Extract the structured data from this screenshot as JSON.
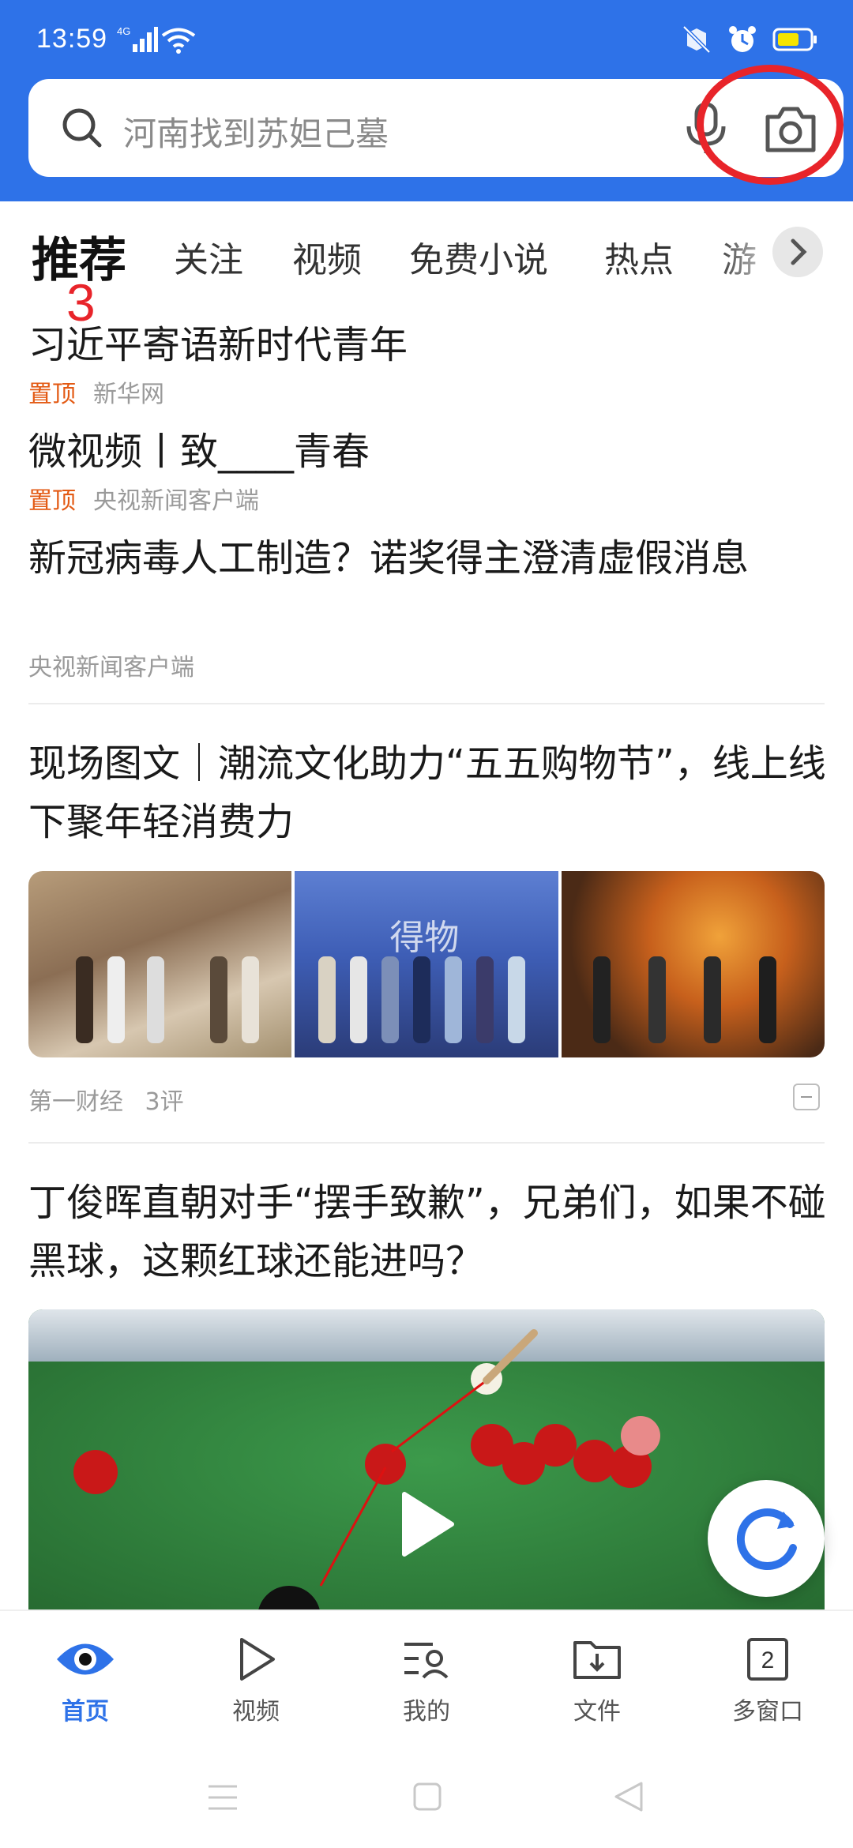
{
  "status_bar": {
    "time": "13:59",
    "network": "4G"
  },
  "search": {
    "placeholder": "河南找到苏妲己墓"
  },
  "tabs": [
    {
      "label": "推荐",
      "active": true
    },
    {
      "label": "关注"
    },
    {
      "label": "视频"
    },
    {
      "label": "免费小说"
    },
    {
      "label": "热点"
    },
    {
      "label": "游"
    }
  ],
  "annotation_number": "3",
  "feed": [
    {
      "title": "习近平寄语新时代青年",
      "pin": "置顶",
      "source": "新华网"
    },
    {
      "title": "微视频丨致____青春",
      "pin": "置顶",
      "source": "央视新闻客户端"
    },
    {
      "title": "新冠病毒人工制造？诺奖得主澄清虚假消息",
      "source": "央视新闻客户端"
    },
    {
      "title": "现场图文｜潮流文化助力“五五购物节”，线上线下聚年轻消费力",
      "source": "第一财经",
      "comments": "3评",
      "image_caption": "得物"
    },
    {
      "title": "丁俊晖直朝对手“摆手致歉”，兄弟们，如果不碰黑球，这颗红球还能进吗？"
    }
  ],
  "bottom_nav": [
    {
      "label": "首页",
      "active": true
    },
    {
      "label": "视频"
    },
    {
      "label": "我的"
    },
    {
      "label": "文件"
    },
    {
      "label": "多窗口",
      "count": "2"
    }
  ],
  "colors": {
    "brand_blue": "#2e72e8",
    "pin_orange": "#e35a14",
    "highlight_red": "#e8242a"
  }
}
